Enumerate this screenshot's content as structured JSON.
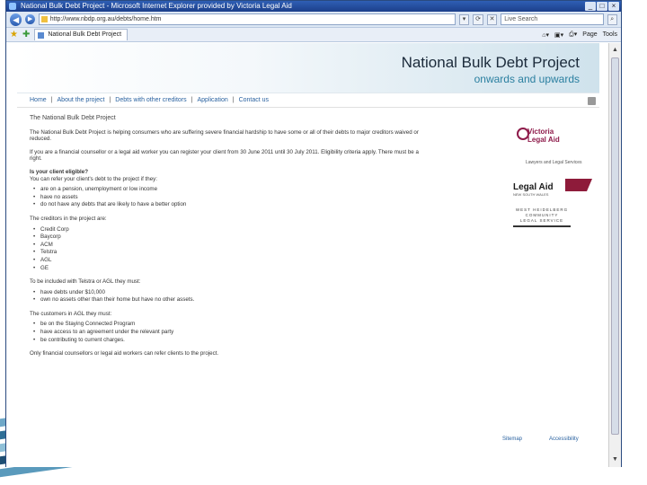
{
  "window": {
    "title": "National Bulk Debt Project - Microsoft Internet Explorer provided by Victoria Legal Aid",
    "controls": [
      "_",
      "□",
      "×"
    ]
  },
  "address": {
    "url": "http://www.nbdp.org.au/debts/home.htm",
    "search_placeholder": "Live Search"
  },
  "tabs": {
    "active": "National Bulk Debt Project",
    "commands": [
      "Page",
      "Tools"
    ]
  },
  "site": {
    "title": "National Bulk Debt Project",
    "tagline": "onwards and upwards",
    "menu": [
      "Home",
      "About the project",
      "Debts with other creditors",
      "Application",
      "Contact us"
    ]
  },
  "content": {
    "heading": "The National Bulk Debt Project",
    "intro": "The National Bulk Debt Project is helping consumers who are suffering severe financial hardship to have some or all of their debts to major creditors waived or reduced.",
    "register": "If you are a financial counsellor or a legal aid worker you can register your client from 30 June 2011 until 30 July 2011. Eligibility criteria apply. There must be a right.",
    "eligible_q": "Is your client eligible?",
    "eligible_intro": "You can refer your client's debt to the project if they:",
    "eligible_list": [
      "are on a pension, unemployment or low income",
      "have no assets",
      "do not have any debts that are likely to have a better option"
    ],
    "creditors_intro": "The creditors in the project are:",
    "creditors": [
      "Credit Corp",
      "Baycorp",
      "ACM",
      "Telstra",
      "AGL",
      "GE"
    ],
    "agl_intro": "To be included with Telstra or AGL they must:",
    "agl_list": [
      "have debts under $10,000",
      "own no assets other than their home but have no other assets."
    ],
    "customers_intro": "The customers in AGL they must:",
    "customers_list": [
      "be on the Staying Connected Program",
      "have access to an agreement under the relevant party",
      "be contributing to current charges."
    ],
    "closing": "Only financial counsellors or legal aid workers can refer clients to the project."
  },
  "sidebar": {
    "via": {
      "line1": "Victoria",
      "line2": "Legal Aid",
      "sub": "Lawyers and Legal Services"
    },
    "la": {
      "name": "Legal Aid",
      "sub": "NEW SOUTH WALES"
    },
    "wm": {
      "line1": "WEST HEIDELBERG",
      "line2": "COMMUNITY",
      "line3": "LEGAL SERVICE"
    }
  },
  "footer": {
    "links": [
      "Sitemap",
      "Accessibility"
    ]
  }
}
